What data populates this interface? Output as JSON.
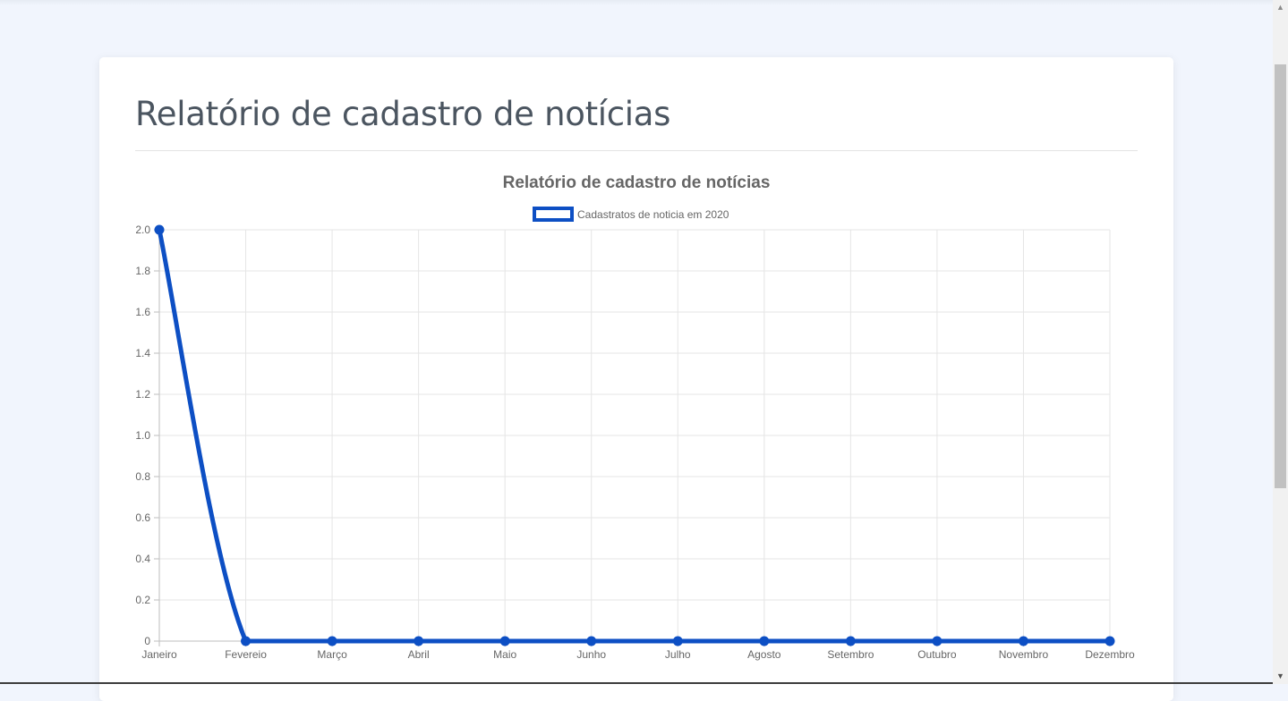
{
  "page": {
    "title": "Relatório de cadastro de notícias"
  },
  "chart_data": {
    "type": "line",
    "title": "Relatório de cadastro de notícias",
    "categories": [
      "Janeiro",
      "Fevereio",
      "Março",
      "Abril",
      "Maio",
      "Junho",
      "Julho",
      "Agosto",
      "Setembro",
      "Outubro",
      "Novembro",
      "Dezembro"
    ],
    "series": [
      {
        "name": "Cadastratos de noticia em 2020",
        "values": [
          2,
          0,
          0,
          0,
          0,
          0,
          0,
          0,
          0,
          0,
          0,
          0
        ],
        "color": "#0d4fc4"
      }
    ],
    "ylim": [
      0,
      2
    ],
    "yticks": [
      "0",
      "0.2",
      "0.4",
      "0.6",
      "0.8",
      "1.0",
      "1.2",
      "1.4",
      "1.6",
      "1.8",
      "2.0"
    ],
    "xlabel": "",
    "ylabel": "",
    "grid": true,
    "legend_position": "top"
  }
}
